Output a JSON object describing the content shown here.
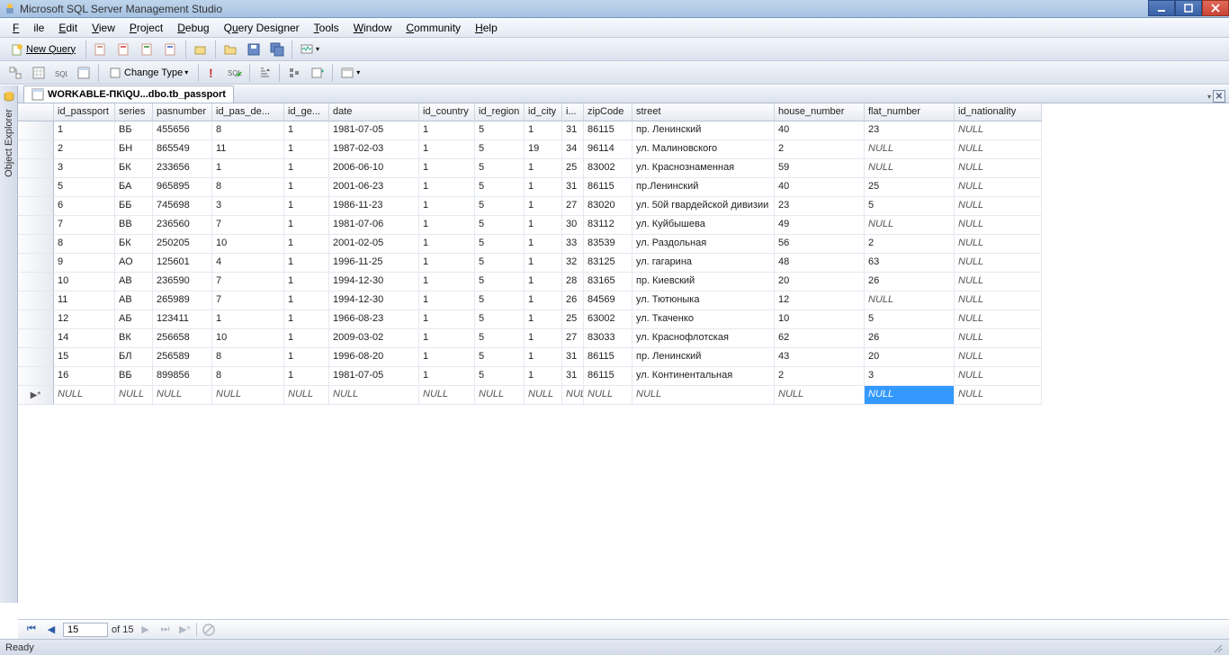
{
  "window": {
    "title": "Microsoft SQL Server Management Studio"
  },
  "menu": {
    "file": "File",
    "edit": "Edit",
    "view": "View",
    "project": "Project",
    "debug": "Debug",
    "query_designer": "Query Designer",
    "tools": "Tools",
    "window": "Window",
    "community": "Community",
    "help": "Help"
  },
  "toolbar1": {
    "new_query": "New Query"
  },
  "toolbar2": {
    "change_type": "Change Type"
  },
  "sidebar": {
    "label": "Object Explorer"
  },
  "tab": {
    "title": "WORKABLE-ПК\\QU...dbo.tb_passport"
  },
  "columns": [
    "id_passport",
    "series",
    "pasnumber",
    "id_pas_de...",
    "id_ge...",
    "date",
    "id_country",
    "id_region",
    "id_city",
    "i...",
    "zipCode",
    "street",
    "house_number",
    "flat_number",
    "id_nationality"
  ],
  "rows": [
    [
      "1",
      "ВБ",
      "455656",
      "8",
      "1",
      "1981-07-05",
      "1",
      "5",
      "1",
      "31",
      "86115",
      "пр. Ленинский",
      "40",
      "23",
      null
    ],
    [
      "2",
      "БН",
      "865549",
      "11",
      "1",
      "1987-02-03",
      "1",
      "5",
      "19",
      "34",
      "96114",
      "ул. Малиновского",
      "2",
      null,
      null
    ],
    [
      "3",
      "БК",
      "233656",
      "1",
      "1",
      "2006-06-10",
      "1",
      "5",
      "1",
      "25",
      "83002",
      "ул. Краснознаменная",
      "59",
      null,
      null
    ],
    [
      "5",
      "БА",
      "965895",
      "8",
      "1",
      "2001-06-23",
      "1",
      "5",
      "1",
      "31",
      "86115",
      "пр.Ленинский",
      "40",
      "25",
      null
    ],
    [
      "6",
      "ББ",
      "745698",
      "3",
      "1",
      "1986-11-23",
      "1",
      "5",
      "1",
      "27",
      "83020",
      "ул. 50й гвардейской дивизии",
      "23",
      "5",
      null
    ],
    [
      "7",
      "ВВ",
      "236560",
      "7",
      "1",
      "1981-07-06",
      "1",
      "5",
      "1",
      "30",
      "83112",
      "ул. Куйбышева",
      "49",
      null,
      null
    ],
    [
      "8",
      "БК",
      "250205",
      "10",
      "1",
      "2001-02-05",
      "1",
      "5",
      "1",
      "33",
      "83539",
      "ул. Раздольная",
      "56",
      "2",
      null
    ],
    [
      "9",
      "АО",
      "125601",
      "4",
      "1",
      "1996-11-25",
      "1",
      "5",
      "1",
      "32",
      "83125",
      "ул. гагарина",
      "48",
      "63",
      null
    ],
    [
      "10",
      "АВ",
      "236590",
      "7",
      "1",
      "1994-12-30",
      "1",
      "5",
      "1",
      "28",
      "83165",
      "пр. Киевский",
      "20",
      "26",
      null
    ],
    [
      "11",
      "АВ",
      "265989",
      "7",
      "1",
      "1994-12-30",
      "1",
      "5",
      "1",
      "26",
      "84569",
      "ул. Тютюныка",
      "12",
      null,
      null
    ],
    [
      "12",
      "АБ",
      "123411",
      "1",
      "1",
      "1966-08-23",
      "1",
      "5",
      "1",
      "25",
      "63002",
      "ул. Ткаченко",
      "10",
      "5",
      null
    ],
    [
      "14",
      "ВК",
      "256658",
      "10",
      "1",
      "2009-03-02",
      "1",
      "5",
      "1",
      "27",
      "83033",
      "ул. Краснофлотская",
      "62",
      "26",
      null
    ],
    [
      "15",
      "БЛ",
      "256589",
      "8",
      "1",
      "1996-08-20",
      "1",
      "5",
      "1",
      "31",
      "86115",
      "пр. Ленинский",
      "43",
      "20",
      null
    ],
    [
      "16",
      "ВБ",
      "899856",
      "8",
      "1",
      "1981-07-05",
      "1",
      "5",
      "1",
      "31",
      "86115",
      "ул. Континентальная",
      "2",
      "3",
      null
    ]
  ],
  "null_label": "NULL",
  "new_row_cols": 15,
  "selected": {
    "row": "new",
    "col": 13
  },
  "nav": {
    "current": "15",
    "of_label": "of 15"
  },
  "status": {
    "text": "Ready"
  }
}
